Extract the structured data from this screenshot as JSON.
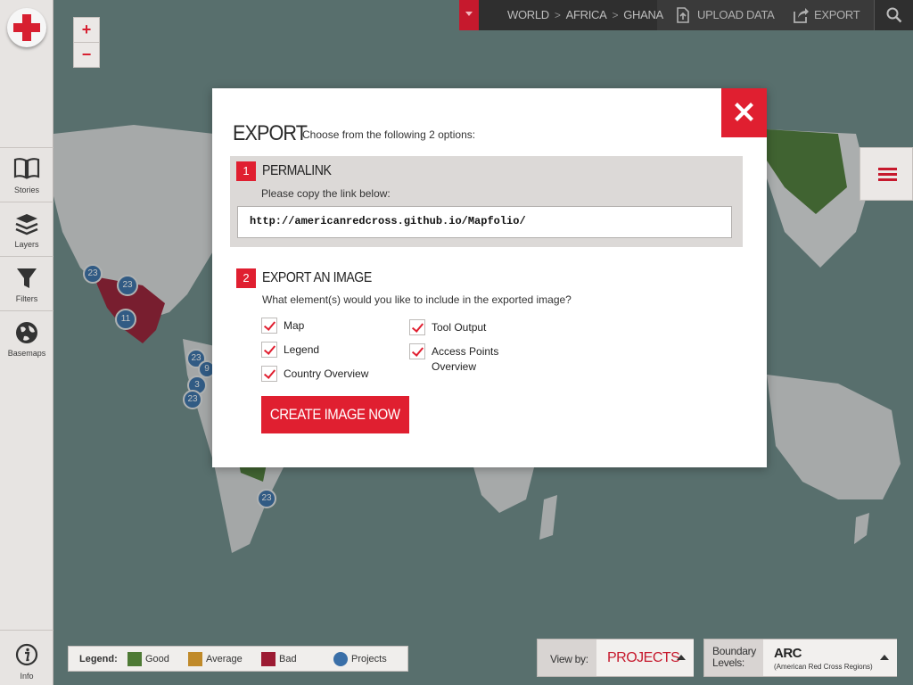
{
  "sidebar": {
    "items": [
      {
        "label": "Stories"
      },
      {
        "label": "Layers"
      },
      {
        "label": "Filters"
      },
      {
        "label": "Basemaps"
      }
    ],
    "info_label": "Info"
  },
  "zoom": {
    "in_label": "+",
    "out_label": "−"
  },
  "topbar": {
    "breadcrumb": [
      "WORLD",
      "AFRICA",
      "GHANA"
    ],
    "separator": ">",
    "upload_label": "UPLOAD DATA",
    "export_label": "EXPORT"
  },
  "markers": [
    "23",
    "23",
    "11",
    "23",
    "9",
    "3",
    "23",
    "23"
  ],
  "modal": {
    "title": "EXPORT",
    "subtitle": "Choose from the following 2 options:",
    "section1": {
      "number": "1",
      "title": "PERMALINK",
      "subtitle": "Please copy the link below:",
      "link": "http://americanredcross.github.io/Mapfolio/"
    },
    "section2": {
      "number": "2",
      "title": "EXPORT AN IMAGE",
      "subtitle": "What element(s) would you like to include in the exported image?",
      "options": [
        {
          "label": "Map",
          "checked": true
        },
        {
          "label": "Legend",
          "checked": true
        },
        {
          "label": "Country Overview",
          "checked": true
        },
        {
          "label": "Tool Output",
          "checked": true
        },
        {
          "label": "Access Points Overview",
          "checked": true
        }
      ],
      "button_label": "CREATE IMAGE NOW"
    }
  },
  "legend": {
    "title": "Legend:",
    "items": [
      {
        "label": "Good",
        "color": "#4e7a35"
      },
      {
        "label": "Average",
        "color": "#c08a2a"
      },
      {
        "label": "Bad",
        "color": "#9c1b33"
      },
      {
        "label": "Projects",
        "color": "#3a6fa8"
      }
    ]
  },
  "viewby": {
    "label": "View by:",
    "value": "PROJECTS"
  },
  "boundary": {
    "label": "Boundary Levels:",
    "value": "ARC",
    "sub": "(American Red Cross Regions)"
  },
  "colors": {
    "accent": "#e01f30",
    "topbar": "#3a3a3a",
    "sidebar": "#e7e4e2"
  }
}
